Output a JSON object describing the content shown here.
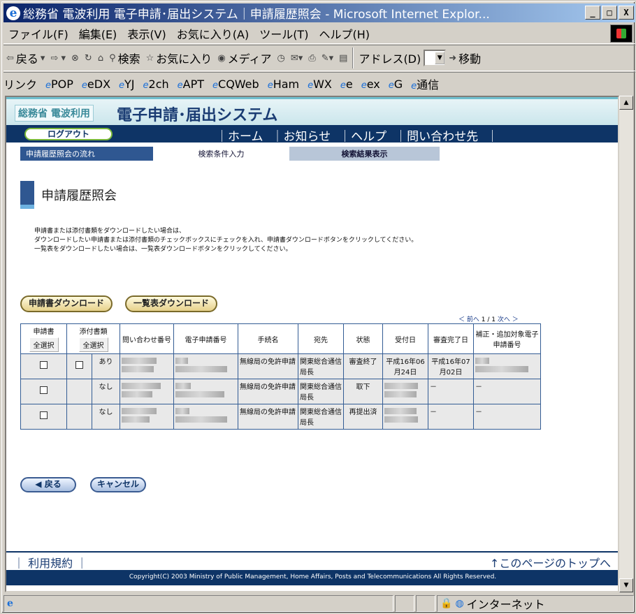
{
  "window": {
    "title": "総務省 電波利用 電子申請･届出システム｜申請履歴照会 - Microsoft Internet Explor...",
    "min": "_",
    "max": "□",
    "close": "X"
  },
  "menu": [
    "ファイル(F)",
    "編集(E)",
    "表示(V)",
    "お気に入り(A)",
    "ツール(T)",
    "ヘルプ(H)"
  ],
  "toolbar": {
    "back": "戻る",
    "search": "検索",
    "favorites": "お気に入り",
    "media": "メディア",
    "address": "アドレス(D)",
    "go": "移動"
  },
  "links": {
    "label": "リンク",
    "items": [
      "POP",
      "eDX",
      "YJ",
      "2ch",
      "APT",
      "CQWeb",
      "Ham",
      "WX",
      "e",
      "ex",
      "G",
      "通信"
    ]
  },
  "site": {
    "ministry": "総務省 電波利用",
    "system": "電子申請･届出システム",
    "logout": "ログアウト"
  },
  "nav": [
    "｜ホーム",
    "｜お知らせ",
    "｜ヘルプ",
    "｜問い合わせ先",
    "｜"
  ],
  "steps": {
    "label": "申請履歴照会の流れ",
    "s1": "検索条件入力",
    "s2": "検索結果表示"
  },
  "page_title": "申請履歴照会",
  "notes": [
    "申請書または添付書類をダウンロードしたい場合は、",
    "ダウンロードしたい申請書または添付書類のチェックボックスにチェックを入れ、申請書ダウンロードボタンをクリックしてください。",
    "一覧表をダウンロードしたい場合は、一覧表ダウンロードボタンをクリックしてください。"
  ],
  "buttons": {
    "dl_app": "申請書ダウンロード",
    "dl_list": "一覧表ダウンロード",
    "back": "◀ 戻る",
    "cancel": "キャンセル",
    "select_all": "全選択"
  },
  "pager": {
    "prev": "＜ 前へ",
    "info": "1 / 1",
    "next": "次へ ＞"
  },
  "table": {
    "headers": [
      "申請書",
      "添付書類",
      "問い合わせ番号",
      "電子申請番号",
      "手続名",
      "宛先",
      "状態",
      "受付日",
      "審査完了日",
      "補正・追加対象電子申請番号"
    ],
    "rows": [
      {
        "att": "あり",
        "proc": "無線局の免許申請",
        "dest": "関東総合通信局長",
        "status": "審査終了",
        "recv": "平成16年06月24日",
        "done": "平成16年07月02日",
        "fix": ""
      },
      {
        "att": "なし",
        "proc": "無線局の免許申請",
        "dest": "関東総合通信局長",
        "status": "取下",
        "recv": "",
        "done": "－",
        "fix": "－"
      },
      {
        "att": "なし",
        "proc": "無線局の免許申請",
        "dest": "関東総合通信局長",
        "status": "再提出済",
        "recv": "",
        "done": "－",
        "fix": "－"
      }
    ]
  },
  "footer": {
    "terms": "｜ 利用規約 ｜",
    "top": "↑このページのトップへ",
    "copyright": "Copyright(C) 2003 Ministry of Public Management, Home Affairs, Posts and Telecommunications All Rights Reserved."
  },
  "status": {
    "zone": "インターネット"
  }
}
